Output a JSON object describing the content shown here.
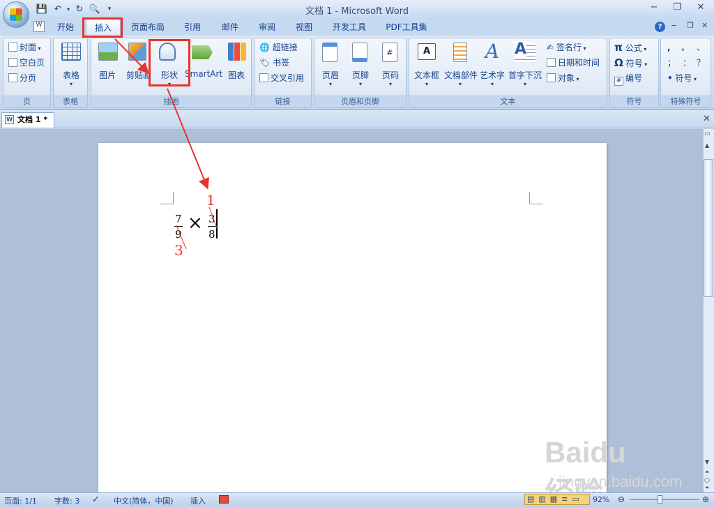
{
  "title": "文档 1 - Microsoft Word",
  "tabs": [
    "开始",
    "插入",
    "页面布局",
    "引用",
    "邮件",
    "审阅",
    "视图",
    "开发工具",
    "PDF工具集"
  ],
  "groups": {
    "page": {
      "label": "页",
      "items": [
        "封面",
        "空白页",
        "分页"
      ]
    },
    "table": {
      "label": "表格",
      "button": "表格"
    },
    "illustrations": {
      "label": "插图",
      "buttons": [
        "图片",
        "剪贴画",
        "形状",
        "SmartArt",
        "图表"
      ]
    },
    "links": {
      "label": "链接",
      "items": [
        "超链接",
        "书签",
        "交叉引用"
      ]
    },
    "header_footer": {
      "label": "页眉和页脚",
      "buttons": [
        "页眉",
        "页脚",
        "页码"
      ]
    },
    "text": {
      "label": "文本",
      "buttons": [
        "文本框",
        "文档部件",
        "艺术字",
        "首字下沉"
      ],
      "items": [
        "签名行",
        "日期和时间",
        "对象"
      ]
    },
    "symbols": {
      "label": "符号",
      "items": [
        "公式",
        "符号",
        "编号"
      ]
    },
    "special": {
      "label": "特殊符号",
      "items": [
        ",",
        "。",
        "、",
        "；",
        "：",
        "？",
        "符号"
      ]
    }
  },
  "document_tab": "文档 1 *",
  "math": {
    "n1": "7",
    "d1": "9",
    "times": "×",
    "n2": "3",
    "d2": "8",
    "mark1": "1",
    "mark3": "3"
  },
  "status": {
    "page": "页面: 1/1",
    "words": "字数: 3",
    "lang": "中文(简体，中国)",
    "mode": "插入",
    "zoom": "92%"
  },
  "watermark": {
    "brand": "Baidu经验",
    "url": "jingyan.baidu.com"
  },
  "colors": {
    "accent": "#15428b",
    "highlight": "#e8332c",
    "ribbon": "#dfe9f5"
  }
}
